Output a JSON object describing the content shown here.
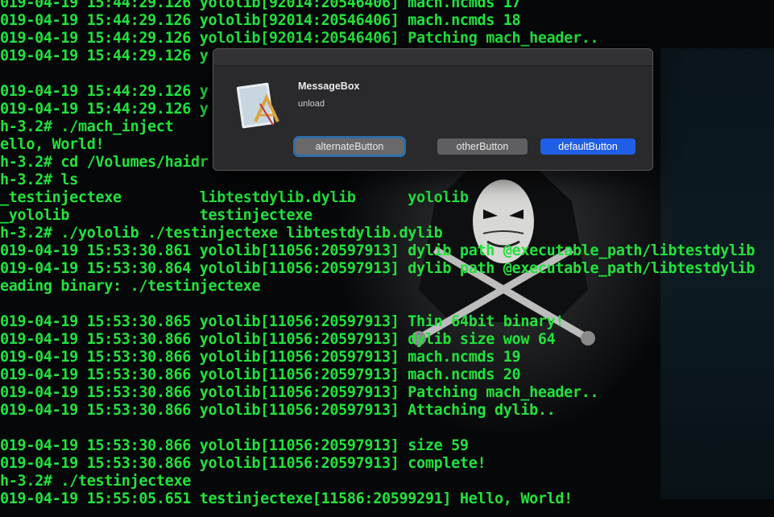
{
  "terminal": {
    "lines": [
      "019-04-19 15:44:29.126 yololib[92014:20546406] mach.ncmds 17",
      "019-04-19 15:44:29.126 yololib[92014:20546406] mach.ncmds 18",
      "019-04-19 15:44:29.126 yololib[92014:20546406] Patching mach_header..",
      "019-04-19 15:44:29.126 y",
      "",
      "019-04-19 15:44:29.126 y",
      "019-04-19 15:44:29.126 y",
      "h-3.2# ./mach_inject",
      "ello, World!",
      "h-3.2# cd /Volumes/haidr",
      "h-3.2# ls",
      "_testinjectexe         libtestdylib.dylib      yololib",
      "_yololib               testinjectexe",
      "h-3.2# ./yololib ./testinjectexe libtestdylib.dylib",
      "019-04-19 15:53:30.861 yololib[11056:20597913] dylib path @executable_path/libtestdylib",
      "019-04-19 15:53:30.864 yololib[11056:20597913] dylib path @executable_path/libtestdylib",
      "eading binary: ./testinjectexe",
      "",
      "019-04-19 15:53:30.865 yololib[11056:20597913] Thin 64bit binary!",
      "019-04-19 15:53:30.866 yololib[11056:20597913] dylib size wow 64",
      "019-04-19 15:53:30.866 yololib[11056:20597913] mach.ncmds 19",
      "019-04-19 15:53:30.866 yololib[11056:20597913] mach.ncmds 20",
      "019-04-19 15:53:30.866 yololib[11056:20597913] Patching mach_header..",
      "019-04-19 15:53:30.866 yololib[11056:20597913] Attaching dylib..",
      "",
      "019-04-19 15:53:30.866 yololib[11056:20597913] size 59",
      "019-04-19 15:53:30.866 yololib[11056:20597913] complete!",
      "h-3.2# ./testinjectexe",
      "019-04-19 15:55:05.651 testinjectexe[11586:20599291] Hello, World!"
    ],
    "text_color": "#22e23c"
  },
  "dialog": {
    "title": "MessageBox",
    "message": "unload",
    "icon": "script-editor-app-icon",
    "buttons": {
      "alternate": "alternateButton",
      "other": "otherButton",
      "default": "defaultButton"
    },
    "default_color": "#1f5ee6"
  }
}
